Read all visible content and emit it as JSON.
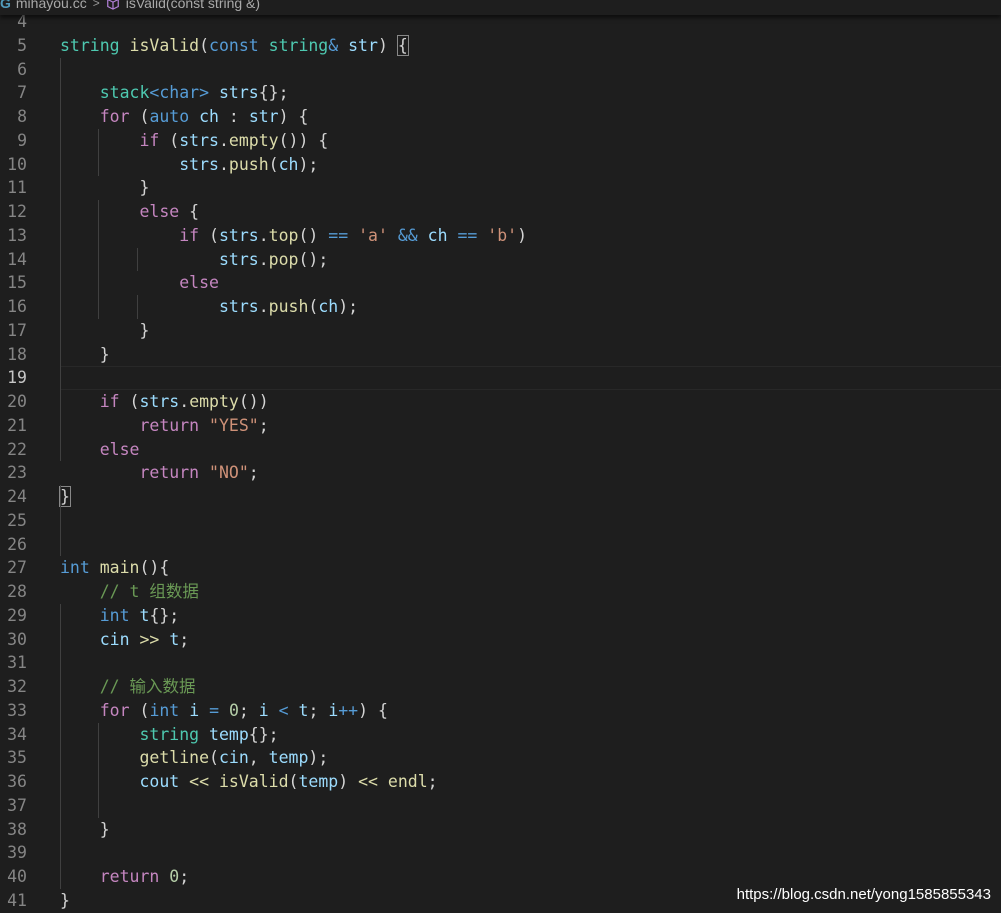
{
  "breadcrumb": {
    "file_icon": "cpp-file-icon",
    "file": "mihayou.cc",
    "separator": ">",
    "symbol_icon": "method-cube-icon",
    "symbol": "isValid(const string &)"
  },
  "editor": {
    "language": "cpp",
    "current_line": "19",
    "lines": [
      {
        "n": "4",
        "t": []
      },
      {
        "n": "5",
        "t": [
          [
            "t",
            "string"
          ],
          [
            "p",
            " "
          ],
          [
            "f",
            "isValid"
          ],
          [
            "p",
            "("
          ],
          [
            "k",
            "const"
          ],
          [
            "p",
            " "
          ],
          [
            "t",
            "string"
          ],
          [
            "k",
            "&"
          ],
          [
            "p",
            " "
          ],
          [
            "v",
            "str"
          ],
          [
            "p",
            ") "
          ],
          [
            "pb",
            "{"
          ]
        ]
      },
      {
        "n": "6",
        "t": []
      },
      {
        "n": "7",
        "t": [
          [
            "p",
            "    "
          ],
          [
            "t",
            "stack"
          ],
          [
            "k",
            "<"
          ],
          [
            "k",
            "char"
          ],
          [
            "k",
            ">"
          ],
          [
            "p",
            " "
          ],
          [
            "v",
            "strs"
          ],
          [
            "p",
            "{};"
          ]
        ]
      },
      {
        "n": "8",
        "t": [
          [
            "p",
            "    "
          ],
          [
            "c",
            "for"
          ],
          [
            "p",
            " ("
          ],
          [
            "k",
            "auto"
          ],
          [
            "p",
            " "
          ],
          [
            "v",
            "ch"
          ],
          [
            "p",
            " : "
          ],
          [
            "v",
            "str"
          ],
          [
            "p",
            ") {"
          ]
        ]
      },
      {
        "n": "9",
        "t": [
          [
            "p",
            "        "
          ],
          [
            "c",
            "if"
          ],
          [
            "p",
            " ("
          ],
          [
            "v",
            "strs"
          ],
          [
            "p",
            "."
          ],
          [
            "f",
            "empty"
          ],
          [
            "p",
            "()) {"
          ]
        ]
      },
      {
        "n": "10",
        "t": [
          [
            "p",
            "            "
          ],
          [
            "v",
            "strs"
          ],
          [
            "p",
            "."
          ],
          [
            "f",
            "push"
          ],
          [
            "p",
            "("
          ],
          [
            "v",
            "ch"
          ],
          [
            "p",
            ");"
          ]
        ]
      },
      {
        "n": "11",
        "t": [
          [
            "p",
            "        }"
          ]
        ]
      },
      {
        "n": "12",
        "t": [
          [
            "p",
            "        "
          ],
          [
            "c",
            "else"
          ],
          [
            "p",
            " {"
          ]
        ]
      },
      {
        "n": "13",
        "t": [
          [
            "p",
            "            "
          ],
          [
            "c",
            "if"
          ],
          [
            "p",
            " ("
          ],
          [
            "v",
            "strs"
          ],
          [
            "p",
            "."
          ],
          [
            "f",
            "top"
          ],
          [
            "p",
            "() "
          ],
          [
            "k",
            "=="
          ],
          [
            "p",
            " "
          ],
          [
            "s",
            "'a'"
          ],
          [
            "p",
            " "
          ],
          [
            "k",
            "&&"
          ],
          [
            "p",
            " "
          ],
          [
            "v",
            "ch"
          ],
          [
            "p",
            " "
          ],
          [
            "k",
            "=="
          ],
          [
            "p",
            " "
          ],
          [
            "s",
            "'b'"
          ],
          [
            "p",
            ")"
          ]
        ]
      },
      {
        "n": "14",
        "t": [
          [
            "p",
            "                "
          ],
          [
            "v",
            "strs"
          ],
          [
            "p",
            "."
          ],
          [
            "f",
            "pop"
          ],
          [
            "p",
            "();"
          ]
        ]
      },
      {
        "n": "15",
        "t": [
          [
            "p",
            "            "
          ],
          [
            "c",
            "else"
          ]
        ]
      },
      {
        "n": "16",
        "t": [
          [
            "p",
            "                "
          ],
          [
            "v",
            "strs"
          ],
          [
            "p",
            "."
          ],
          [
            "f",
            "push"
          ],
          [
            "p",
            "("
          ],
          [
            "v",
            "ch"
          ],
          [
            "p",
            ");"
          ]
        ]
      },
      {
        "n": "17",
        "t": [
          [
            "p",
            "        }"
          ]
        ]
      },
      {
        "n": "18",
        "t": [
          [
            "p",
            "    }"
          ]
        ]
      },
      {
        "n": "19",
        "t": []
      },
      {
        "n": "20",
        "t": [
          [
            "p",
            "    "
          ],
          [
            "c",
            "if"
          ],
          [
            "p",
            " ("
          ],
          [
            "v",
            "strs"
          ],
          [
            "p",
            "."
          ],
          [
            "f",
            "empty"
          ],
          [
            "p",
            "())"
          ]
        ]
      },
      {
        "n": "21",
        "t": [
          [
            "p",
            "        "
          ],
          [
            "c",
            "return"
          ],
          [
            "p",
            " "
          ],
          [
            "s",
            "\"YES\""
          ],
          [
            "p",
            ";"
          ]
        ]
      },
      {
        "n": "22",
        "t": [
          [
            "p",
            "    "
          ],
          [
            "c",
            "else"
          ]
        ]
      },
      {
        "n": "23",
        "t": [
          [
            "p",
            "        "
          ],
          [
            "c",
            "return"
          ],
          [
            "p",
            " "
          ],
          [
            "s",
            "\"NO\""
          ],
          [
            "p",
            ";"
          ]
        ]
      },
      {
        "n": "24",
        "t": [
          [
            "pb",
            "}"
          ]
        ]
      },
      {
        "n": "25",
        "t": []
      },
      {
        "n": "26",
        "t": []
      },
      {
        "n": "27",
        "t": [
          [
            "k",
            "int"
          ],
          [
            "p",
            " "
          ],
          [
            "f",
            "main"
          ],
          [
            "p",
            "(){"
          ]
        ]
      },
      {
        "n": "28",
        "t": [
          [
            "p",
            "    "
          ],
          [
            "m",
            "// t 组数据"
          ]
        ]
      },
      {
        "n": "29",
        "t": [
          [
            "p",
            "    "
          ],
          [
            "k",
            "int"
          ],
          [
            "p",
            " "
          ],
          [
            "v",
            "t"
          ],
          [
            "p",
            "{};"
          ]
        ]
      },
      {
        "n": "30",
        "t": [
          [
            "p",
            "    "
          ],
          [
            "v",
            "cin"
          ],
          [
            "p",
            " "
          ],
          [
            "f",
            ">>"
          ],
          [
            "p",
            " "
          ],
          [
            "v",
            "t"
          ],
          [
            "p",
            ";"
          ]
        ]
      },
      {
        "n": "31",
        "t": []
      },
      {
        "n": "32",
        "t": [
          [
            "p",
            "    "
          ],
          [
            "m",
            "// 输入数据"
          ]
        ]
      },
      {
        "n": "33",
        "t": [
          [
            "p",
            "    "
          ],
          [
            "c",
            "for"
          ],
          [
            "p",
            " ("
          ],
          [
            "k",
            "int"
          ],
          [
            "p",
            " "
          ],
          [
            "v",
            "i"
          ],
          [
            "p",
            " "
          ],
          [
            "k",
            "="
          ],
          [
            "p",
            " "
          ],
          [
            "n",
            "0"
          ],
          [
            "p",
            "; "
          ],
          [
            "v",
            "i"
          ],
          [
            "p",
            " "
          ],
          [
            "k",
            "<"
          ],
          [
            "p",
            " "
          ],
          [
            "v",
            "t"
          ],
          [
            "p",
            "; "
          ],
          [
            "v",
            "i"
          ],
          [
            "k",
            "++"
          ],
          [
            "p",
            ") {"
          ]
        ]
      },
      {
        "n": "34",
        "t": [
          [
            "p",
            "        "
          ],
          [
            "t",
            "string"
          ],
          [
            "p",
            " "
          ],
          [
            "v",
            "temp"
          ],
          [
            "p",
            "{};"
          ]
        ]
      },
      {
        "n": "35",
        "t": [
          [
            "p",
            "        "
          ],
          [
            "f",
            "getline"
          ],
          [
            "p",
            "("
          ],
          [
            "v",
            "cin"
          ],
          [
            "p",
            ", "
          ],
          [
            "v",
            "temp"
          ],
          [
            "p",
            ");"
          ]
        ]
      },
      {
        "n": "36",
        "t": [
          [
            "p",
            "        "
          ],
          [
            "v",
            "cout"
          ],
          [
            "p",
            " "
          ],
          [
            "f",
            "<<"
          ],
          [
            "p",
            " "
          ],
          [
            "f",
            "isValid"
          ],
          [
            "p",
            "("
          ],
          [
            "v",
            "temp"
          ],
          [
            "p",
            ") "
          ],
          [
            "f",
            "<<"
          ],
          [
            "p",
            " "
          ],
          [
            "f",
            "endl"
          ],
          [
            "p",
            ";"
          ]
        ]
      },
      {
        "n": "37",
        "t": []
      },
      {
        "n": "38",
        "t": [
          [
            "p",
            "    }"
          ]
        ]
      },
      {
        "n": "39",
        "t": []
      },
      {
        "n": "40",
        "t": [
          [
            "p",
            "    "
          ],
          [
            "c",
            "return"
          ],
          [
            "p",
            " "
          ],
          [
            "n",
            "0"
          ],
          [
            "p",
            ";"
          ]
        ]
      },
      {
        "n": "41",
        "t": [
          [
            "p",
            "}"
          ]
        ]
      }
    ]
  },
  "watermark": "https://blog.csdn.net/yong1585855343"
}
